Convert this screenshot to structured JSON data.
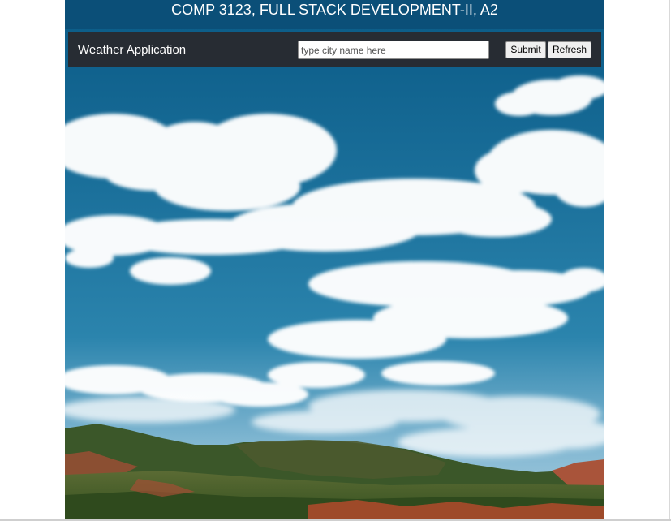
{
  "header": {
    "title": "COMP 3123, FULL STACK DEVELOPMENT-II, A2"
  },
  "navbar": {
    "brand": "Weather Application",
    "search": {
      "placeholder": "type city name here",
      "value": ""
    },
    "submit_label": "Submit",
    "refresh_label": "Refresh"
  },
  "background": {
    "icon": "cloudy-sky-landscape-image"
  },
  "colors": {
    "title_bar": "#0b4f78",
    "navbar": "#272c33",
    "sky": "#1f6e97"
  }
}
